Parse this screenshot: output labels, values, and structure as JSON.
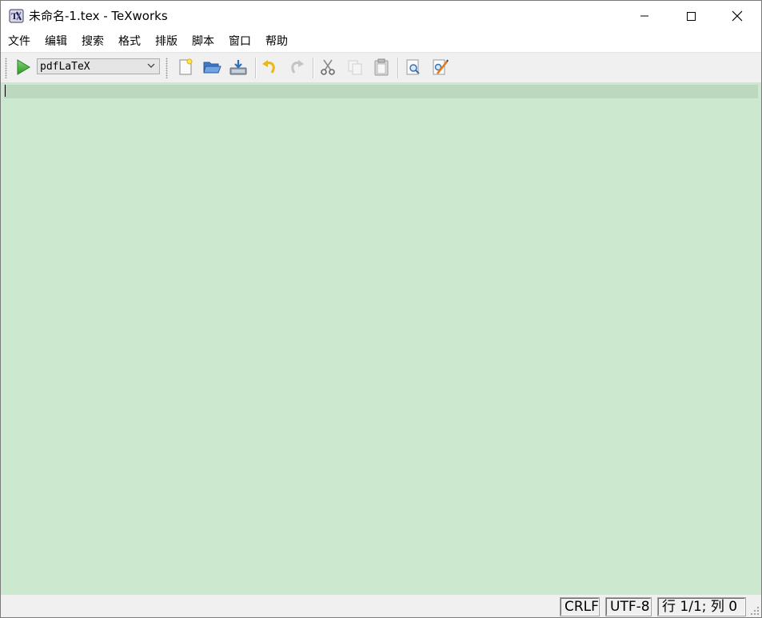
{
  "window": {
    "title": "未命名-1.tex - TeXworks"
  },
  "menu": {
    "items": [
      "文件",
      "编辑",
      "搜索",
      "格式",
      "排版",
      "脚本",
      "窗口",
      "帮助"
    ]
  },
  "toolbar": {
    "typeset_engine": "pdfLaTeX",
    "icons": [
      "typeset-play-icon",
      "new-document-icon",
      "open-folder-icon",
      "save-icon",
      "undo-icon",
      "redo-icon",
      "cut-icon",
      "copy-icon",
      "paste-icon",
      "find-icon",
      "replace-icon"
    ]
  },
  "editor": {
    "content": "",
    "background": "#cce8cf",
    "current_line_background": "#bcd9c0"
  },
  "status": {
    "line_ending": "CRLF",
    "encoding": "UTF-8",
    "position": "行 1/1;  列 0"
  }
}
